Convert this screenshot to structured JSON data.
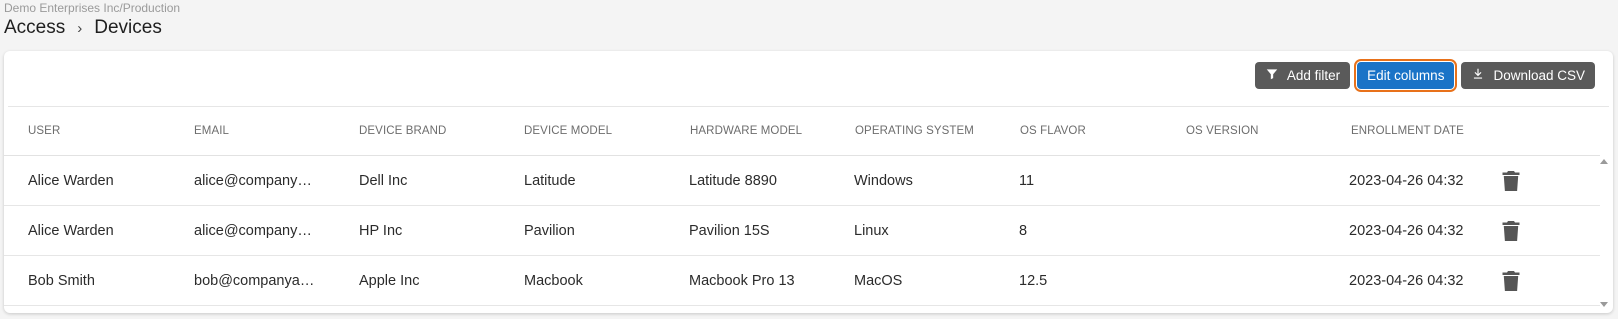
{
  "header": {
    "org_path": "Demo Enterprises Inc/Production",
    "breadcrumb": {
      "parent": "Access",
      "separator": "›",
      "current": "Devices"
    }
  },
  "toolbar": {
    "add_filter_label": "Add filter",
    "edit_columns_label": "Edit columns",
    "download_csv_label": "Download CSV"
  },
  "table": {
    "columns": [
      "USER",
      "EMAIL",
      "DEVICE BRAND",
      "DEVICE MODEL",
      "HARDWARE MODEL",
      "OPERATING SYSTEM",
      "OS FLAVOR",
      "OS VERSION",
      "ENROLLMENT DATE"
    ],
    "rows": [
      {
        "user": "Alice Warden",
        "email": "alice@companya…",
        "brand": "Dell Inc",
        "model": "Latitude",
        "hardware": "Latitude 8890",
        "os": "Windows",
        "flavor": "11",
        "version": "",
        "enrolled": "2023-04-26 04:32"
      },
      {
        "user": "Alice Warden",
        "email": "alice@companya…",
        "brand": "HP Inc",
        "model": "Pavilion",
        "hardware": "Pavilion 15S",
        "os": "Linux",
        "flavor": "8",
        "version": "",
        "enrolled": "2023-04-26 04:32"
      },
      {
        "user": "Bob Smith",
        "email": "bob@companyaz…",
        "brand": "Apple Inc",
        "model": "Macbook",
        "hardware": "Macbook Pro 13",
        "os": "MacOS",
        "flavor": "12.5",
        "version": "",
        "enrolled": "2023-04-26 04:32"
      }
    ]
  },
  "icons": {
    "filter": "filter-icon",
    "download": "download-icon",
    "delete": "trash-icon"
  },
  "colors": {
    "primary_button": "#1a73c7",
    "focus_outline": "#e8711a",
    "secondary_button": "#5a5a5a"
  }
}
